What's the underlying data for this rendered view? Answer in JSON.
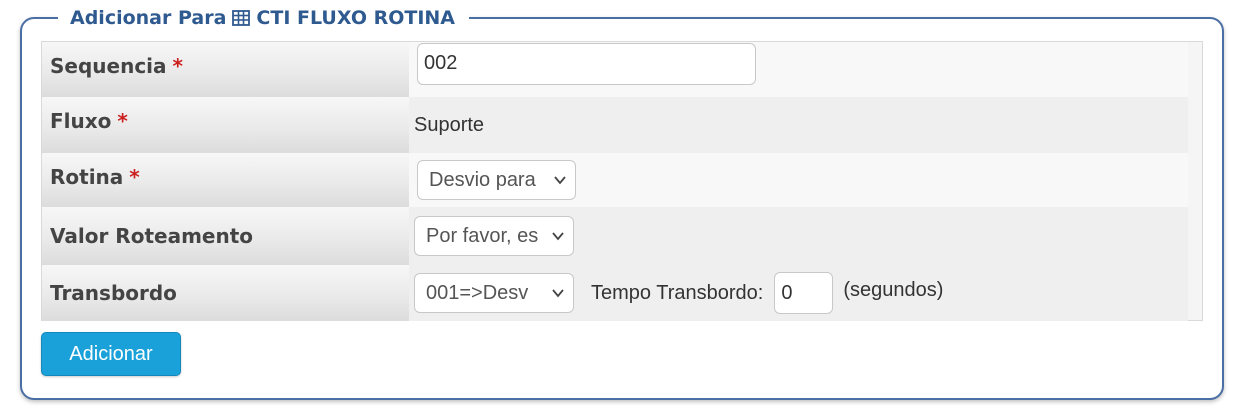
{
  "legend": {
    "prefix": "Adicionar Para",
    "title": "CTI FLUXO ROTINA",
    "icon": "table-icon",
    "color": "#2f5a8f"
  },
  "form": {
    "sequencia": {
      "label": "Sequencia",
      "required": "*",
      "value": "002"
    },
    "fluxo": {
      "label": "Fluxo",
      "required": "*",
      "value": "Suporte"
    },
    "rotina": {
      "label": "Rotina",
      "required": "*",
      "selected": "Desvio para"
    },
    "valor_roteamento": {
      "label": "Valor Roteamento",
      "selected": "Por favor, es"
    },
    "transbordo": {
      "label": "Transbordo",
      "selected": "001=>Desv",
      "tempo_label": "Tempo Transbordo:",
      "tempo_value": "0",
      "unit": "(segundos)"
    }
  },
  "submit_label": "Adicionar",
  "colors": {
    "accent": "#1ba1d9",
    "required": "#cc1f1f",
    "border": "#4a6fa5"
  }
}
